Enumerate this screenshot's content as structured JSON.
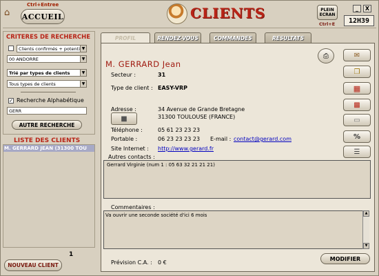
{
  "header": {
    "shortcut_top": "Ctrl+Entree",
    "accueil_label": "ACCUEIL",
    "title": "CLIENTS",
    "plein_ecran_label": "PLEIN ECRAN",
    "plein_ecran_shortcut": "Ctrl+E",
    "minimize": "_",
    "close": "X",
    "clock": "12H39"
  },
  "search": {
    "title": "CRITERES DE RECHERCHE",
    "confirmed_checked": false,
    "confirmed_select": "Clients confirmés + potenti",
    "country_select": "00 ANDORRE",
    "sort_select": "Trié par types de clients",
    "type_select": "Tous types de clients",
    "alpha_checked": true,
    "alpha_label": "Recherche Alphabétique",
    "alpha_value": "GERR",
    "other_search_button": "AUTRE RECHERCHE"
  },
  "list": {
    "title": "LISTE DES CLIENTS",
    "items": [
      "M. GERRARD JEAN (31300 TOU"
    ],
    "count": "1",
    "new_client_button": "NOUVEAU CLIENT"
  },
  "tabs": [
    {
      "label": "PROFIL",
      "active": true
    },
    {
      "label": "RENDEZ-VOUS",
      "active": false
    },
    {
      "label": "COMMANDES",
      "active": false
    },
    {
      "label": "RESULTATS",
      "active": false
    }
  ],
  "profile": {
    "name": "M. GERRARD Jean",
    "secteur_label": "Secteur :",
    "secteur_value": "31",
    "type_label": "Type de client :",
    "type_value": "EASY-VRP",
    "adresse_label": "Adresse :",
    "adresse_line1": "34 Avenue de Grande Bretagne",
    "adresse_line2": "31300  TOULOUSE (FRANCE)",
    "tel_label": "Téléphone :",
    "tel_value": "05 61 23 23 23",
    "portable_label": "Portable :",
    "portable_value": "06 23 23 23 23",
    "email_label": "E-mail :",
    "email_value": "contact@gerard.com",
    "site_label": "Site Internet :",
    "site_value": "http://www.gerard.fr",
    "contacts_label": "Autres contacts :",
    "contacts_value": "Gerrard Virginie (num 1 : 05 63 32 21 21 21)",
    "comments_label": "Commentaires :",
    "comments_value": "Va ouvrir une seconde société d'ici 6 mois",
    "ca_label": "Prévision C.A. :",
    "ca_value": "0 €",
    "modify_button": "MODIFIER"
  },
  "icons": {
    "home": "home-icon",
    "print": "printer-icon",
    "mail": "envelope-icon",
    "copy": "documents-icon",
    "table": "table-icon",
    "factory": "factory-icon",
    "card": "card-icon",
    "percent": "percent-icon",
    "catalog": "catalog-icon",
    "map": "map-icon"
  },
  "colors": {
    "accent_red": "#b82417",
    "selected_row": "#a7a9c6",
    "link_blue": "#0000c0"
  }
}
